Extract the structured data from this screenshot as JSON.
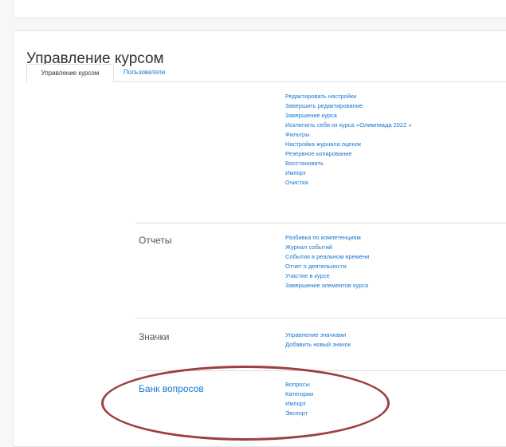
{
  "page": {
    "title": "Управление курсом"
  },
  "tabs": [
    {
      "label": "Управление курсом",
      "active": true
    },
    {
      "label": "Пользователи",
      "active": false
    }
  ],
  "sections": {
    "course": {
      "items": [
        "Редактировать настройки",
        "Завершить редактирование",
        "Завершение курса",
        "Исключить себя из курса «Олимпиада 2022 »",
        "Фильтры",
        "Настройка журнала оценок",
        "Резервное копирование",
        "Восстановить",
        "Импорт",
        "Очистка"
      ]
    },
    "reports": {
      "title": "Отчеты",
      "items": [
        "Разбивка по компетенциям",
        "Журнал событий",
        "События в реальном времени",
        "Отчет о деятельности",
        "Участие в курсе",
        "Завершение элементов курса"
      ]
    },
    "badges": {
      "title": "Значки",
      "items": [
        "Управление значками",
        "Добавить новый значок"
      ]
    },
    "question_bank": {
      "title": "Банк вопросов",
      "items": [
        "Вопросы",
        "Категории",
        "Импорт",
        "Экспорт"
      ]
    }
  },
  "colors": {
    "link": "#1177d1",
    "annotation": "#9e3f3f"
  }
}
